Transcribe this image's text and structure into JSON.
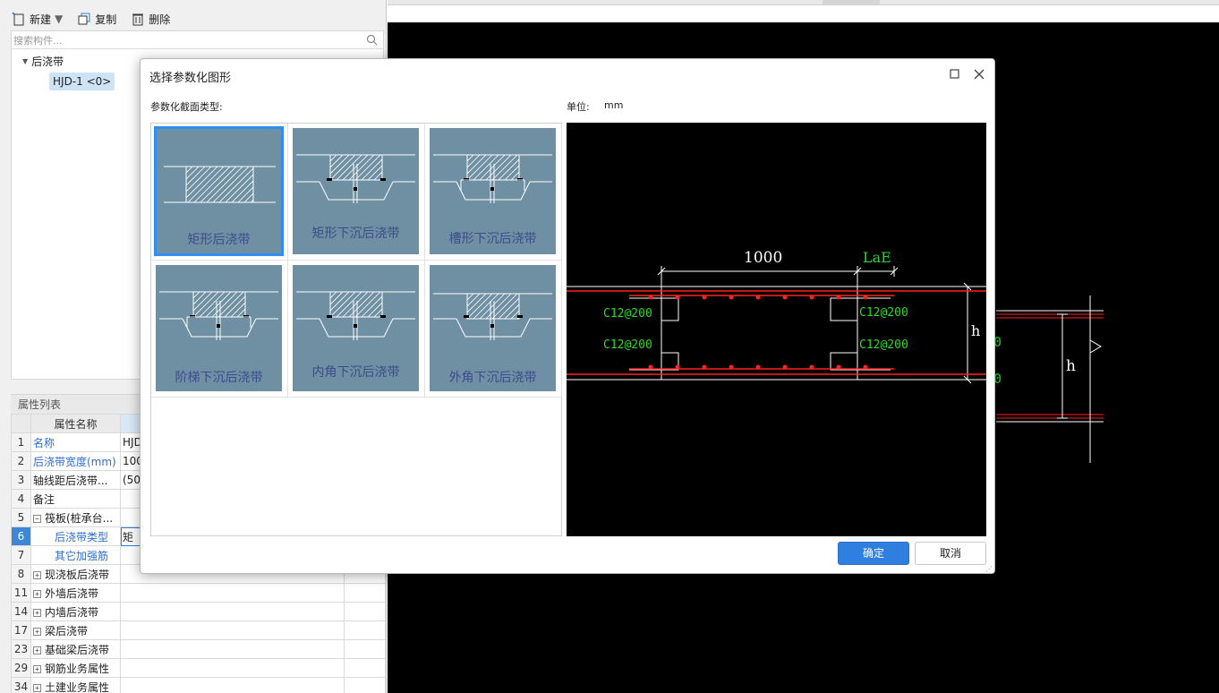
{
  "toolbar": {
    "new_label": "新建",
    "copy_label": "复制",
    "delete_label": "删除"
  },
  "search": {
    "placeholder": "搜索构件..."
  },
  "tree": {
    "root_label": "后浇带",
    "child_label": "HJD-1 <0>"
  },
  "properties": {
    "header": "属性列表",
    "col_name": "属性名称",
    "col_value": "",
    "rows": [
      {
        "idx": "1",
        "name": "名称",
        "value": "HJD",
        "blue": true,
        "expander": "",
        "indent": false
      },
      {
        "idx": "2",
        "name": "后浇带宽度(mm)",
        "value": "100",
        "blue": true,
        "expander": "",
        "indent": false
      },
      {
        "idx": "3",
        "name": "轴线距后浇带...",
        "value": "(50",
        "blue": false,
        "expander": "",
        "indent": false
      },
      {
        "idx": "4",
        "name": "备注",
        "value": "",
        "blue": false,
        "expander": "",
        "indent": false
      },
      {
        "idx": "5",
        "name": "筏板(桩承台...",
        "value": "",
        "blue": false,
        "expander": "−",
        "indent": false
      },
      {
        "idx": "6",
        "name": "后浇带类型",
        "value": "矩",
        "blue": true,
        "expander": "",
        "indent": true,
        "selected": true
      },
      {
        "idx": "7",
        "name": "其它加强筋",
        "value": "",
        "blue": true,
        "expander": "",
        "indent": true
      },
      {
        "idx": "8",
        "name": "现浇板后浇带",
        "value": "",
        "blue": false,
        "expander": "+",
        "indent": false
      },
      {
        "idx": "11",
        "name": "外墙后浇带",
        "value": "",
        "blue": false,
        "expander": "+",
        "indent": false
      },
      {
        "idx": "14",
        "name": "内墙后浇带",
        "value": "",
        "blue": false,
        "expander": "+",
        "indent": false
      },
      {
        "idx": "17",
        "name": "梁后浇带",
        "value": "",
        "blue": false,
        "expander": "+",
        "indent": false
      },
      {
        "idx": "23",
        "name": "基础梁后浇带",
        "value": "",
        "blue": false,
        "expander": "+",
        "indent": false
      },
      {
        "idx": "29",
        "name": "钢筋业务属性",
        "value": "",
        "blue": false,
        "expander": "+",
        "indent": false
      },
      {
        "idx": "34",
        "name": "土建业务属性",
        "value": "",
        "blue": false,
        "expander": "+",
        "indent": false
      }
    ]
  },
  "dialog": {
    "title": "选择参数化图形",
    "section_label": "参数化截面类型:",
    "unit_label": "单位:",
    "unit_value": "mm",
    "ok_label": "确定",
    "cancel_label": "取消",
    "shapes": [
      {
        "label": "矩形后浇带",
        "kind": "rect",
        "selected": true
      },
      {
        "label": "矩形下沉后浇带",
        "kind": "rect-sunk",
        "selected": false
      },
      {
        "label": "槽形下沉后浇带",
        "kind": "groove",
        "selected": false
      },
      {
        "label": "阶梯下沉后浇带",
        "kind": "step",
        "selected": false
      },
      {
        "label": "内角下沉后浇带",
        "kind": "inner",
        "selected": false
      },
      {
        "label": "外角下沉后浇带",
        "kind": "outer",
        "selected": false
      }
    ],
    "preview": {
      "width_dim": "1000",
      "lae_label": "LaE",
      "rebar_labels": [
        "C12@200",
        "C12@200",
        "C12@200",
        "C12@200"
      ],
      "h_label": "h",
      "colors": {
        "dim": "#ffffff",
        "rebar_text": "#22dd22",
        "rebar": "#ff2020",
        "lae": "#22dd22"
      }
    }
  },
  "canvas": {
    "h_label": "h"
  }
}
